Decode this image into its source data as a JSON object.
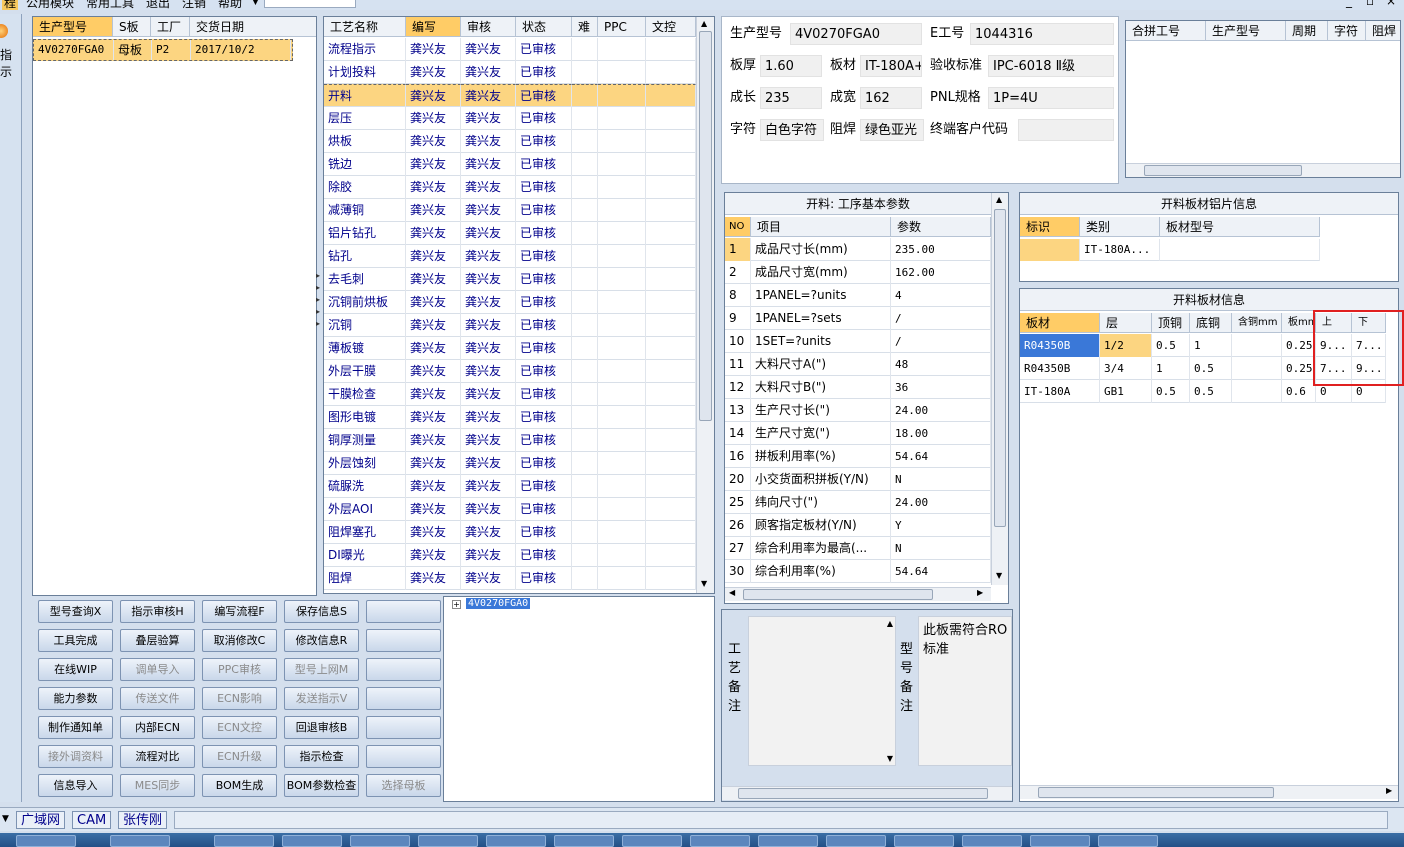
{
  "menubar": {
    "items": [
      "程",
      "公用模块",
      "常用工具",
      "退出",
      "注销",
      "帮助"
    ],
    "window_controls": [
      "_",
      "▫",
      "×"
    ]
  },
  "left_strip": {
    "label": "指示"
  },
  "model_table": {
    "headers": [
      "生产型号",
      "S板",
      "工厂",
      "交货日期"
    ],
    "rows": [
      [
        "4V0270FGA0",
        "母板",
        "P2",
        "2017/10/2"
      ]
    ]
  },
  "process_table": {
    "headers": [
      "工艺名称",
      "编写",
      "审核",
      "状态",
      "难",
      "PPC",
      "文控"
    ],
    "rows": [
      [
        "流程指示",
        "龚兴友",
        "龚兴友",
        "已审核"
      ],
      [
        "计划投料",
        "龚兴友",
        "龚兴友",
        "已审核"
      ],
      [
        "开料",
        "龚兴友",
        "龚兴友",
        "已审核"
      ],
      [
        "层压",
        "龚兴友",
        "龚兴友",
        "已审核"
      ],
      [
        "烘板",
        "龚兴友",
        "龚兴友",
        "已审核"
      ],
      [
        "铣边",
        "龚兴友",
        "龚兴友",
        "已审核"
      ],
      [
        "除胶",
        "龚兴友",
        "龚兴友",
        "已审核"
      ],
      [
        "减薄铜",
        "龚兴友",
        "龚兴友",
        "已审核"
      ],
      [
        "铝片钻孔",
        "龚兴友",
        "龚兴友",
        "已审核"
      ],
      [
        "钻孔",
        "龚兴友",
        "龚兴友",
        "已审核"
      ],
      [
        "去毛刺",
        "龚兴友",
        "龚兴友",
        "已审核"
      ],
      [
        "沉铜前烘板",
        "龚兴友",
        "龚兴友",
        "已审核"
      ],
      [
        "沉铜",
        "龚兴友",
        "龚兴友",
        "已审核"
      ],
      [
        "薄板镀",
        "龚兴友",
        "龚兴友",
        "已审核"
      ],
      [
        "外层干膜",
        "龚兴友",
        "龚兴友",
        "已审核"
      ],
      [
        "干膜检查",
        "龚兴友",
        "龚兴友",
        "已审核"
      ],
      [
        "图形电镀",
        "龚兴友",
        "龚兴友",
        "已审核"
      ],
      [
        "铜厚测量",
        "龚兴友",
        "龚兴友",
        "已审核"
      ],
      [
        "外层蚀刻",
        "龚兴友",
        "龚兴友",
        "已审核"
      ],
      [
        "硫脲洗",
        "龚兴友",
        "龚兴友",
        "已审核"
      ],
      [
        "外层AOI",
        "龚兴友",
        "龚兴友",
        "已审核"
      ],
      [
        "阻焊塞孔",
        "龚兴友",
        "龚兴友",
        "已审核"
      ],
      [
        "DI曝光",
        "龚兴友",
        "龚兴友",
        "已审核"
      ],
      [
        "阻焊",
        "龚兴友",
        "龚兴友",
        "已审核"
      ]
    ],
    "selected_index": 2
  },
  "buttons": [
    [
      "型号查询X",
      "指示审核H",
      "编写流程F",
      "保存信息S",
      ""
    ],
    [
      "工具完成",
      "叠层验算",
      "取消修改C",
      "修改信息R",
      ""
    ],
    [
      "在线WIP",
      "调单导入",
      "PPC审核",
      "型号上网M",
      ""
    ],
    [
      "能力参数",
      "传送文件",
      "ECN影响",
      "发送指示V",
      ""
    ],
    [
      "制作通知单",
      "内部ECN",
      "ECN文控",
      "回退审核B",
      ""
    ],
    [
      "接外调资料",
      "流程对比",
      "ECN升级",
      "指示检查",
      ""
    ],
    [
      "信息导入",
      "MES同步",
      "BOM生成",
      "BOM参数检查",
      "选择母板"
    ]
  ],
  "disabled_buttons": [
    "调单导入",
    "PPC审核",
    "型号上网M",
    "传送文件",
    "ECN影响",
    "发送指示V",
    "ECN文控",
    "接外调资料",
    "ECN升级",
    "MES同步",
    "选择母板"
  ],
  "tree": {
    "node": "4V0270FGA0"
  },
  "info": {
    "prod_model_label": "生产型号",
    "prod_model": "4V0270FGA0",
    "e_no_label": "E工号",
    "e_no": "1044316",
    "thickness_label": "板厚",
    "thickness": "1.60",
    "material_label": "板材",
    "material": "IT-180A+",
    "accept_label": "验收标准",
    "accept": "IPC-6018 Ⅱ级",
    "len_label": "成长",
    "len": "235",
    "width_label": "成宽",
    "width": "162",
    "pnl_label": "PNL规格",
    "pnl": "1P=4U",
    "char_label": "字符",
    "char": "白色字符",
    "mask_label": "阻焊",
    "mask": "绿色亚光",
    "cust_label": "终端客户代码",
    "cust": ""
  },
  "combine_table": {
    "headers": [
      "合拼工号",
      "生产型号",
      "周期",
      "字符",
      "阻焊"
    ]
  },
  "params": {
    "title": "开料: 工序基本参数",
    "headers": [
      "NO",
      "项目",
      "参数"
    ],
    "rows": [
      [
        "1",
        "成品尺寸长(mm)",
        "235.00"
      ],
      [
        "2",
        "成品尺寸宽(mm)",
        "162.00"
      ],
      [
        "8",
        "1PANEL=?units",
        "4"
      ],
      [
        "9",
        "1PANEL=?sets",
        "/"
      ],
      [
        "10",
        "1SET=?units",
        "/"
      ],
      [
        "11",
        "大料尺寸A(\")",
        "48"
      ],
      [
        "12",
        "大料尺寸B(\")",
        "36"
      ],
      [
        "13",
        "生产尺寸长(\")",
        "24.00"
      ],
      [
        "14",
        "生产尺寸宽(\")",
        "18.00"
      ],
      [
        "16",
        "拼板利用率(%)",
        "54.64"
      ],
      [
        "20",
        "小交货面积拼板(Y/N)",
        "N"
      ],
      [
        "25",
        "纬向尺寸(\")",
        "24.00"
      ],
      [
        "26",
        "顾客指定板材(Y/N)",
        "Y"
      ],
      [
        "27",
        "综合利用率为最高(...",
        "N"
      ],
      [
        "30",
        "综合利用率(%)",
        "54.64"
      ]
    ]
  },
  "alu": {
    "title": "开料板材铝片信息",
    "headers": [
      "标识",
      "类别",
      "板材型号"
    ],
    "rows": [
      [
        "",
        "IT-180A...",
        ""
      ]
    ]
  },
  "sheet": {
    "title": "开料板材信息",
    "headers": [
      "板材",
      "层",
      "顶铜",
      "底铜",
      "含铜mm",
      "板mm",
      "上",
      "下"
    ],
    "rows": [
      [
        "R04350B",
        "1/2",
        "0.5",
        "1",
        "",
        "0.25",
        "9...",
        "7..."
      ],
      [
        "R04350B",
        "3/4",
        "1",
        "0.5",
        "",
        "0.25",
        "7...",
        "9..."
      ],
      [
        "IT-180A",
        "GB1",
        "0.5",
        "0.5",
        "",
        "0.6",
        "0",
        "0"
      ]
    ]
  },
  "remarks": {
    "craft_label": "工艺备注",
    "model_label": "型号备注",
    "model_text": "此板需符合RO标准"
  },
  "bottombar": {
    "items": [
      "广域网",
      "CAM",
      "张传刚"
    ]
  }
}
